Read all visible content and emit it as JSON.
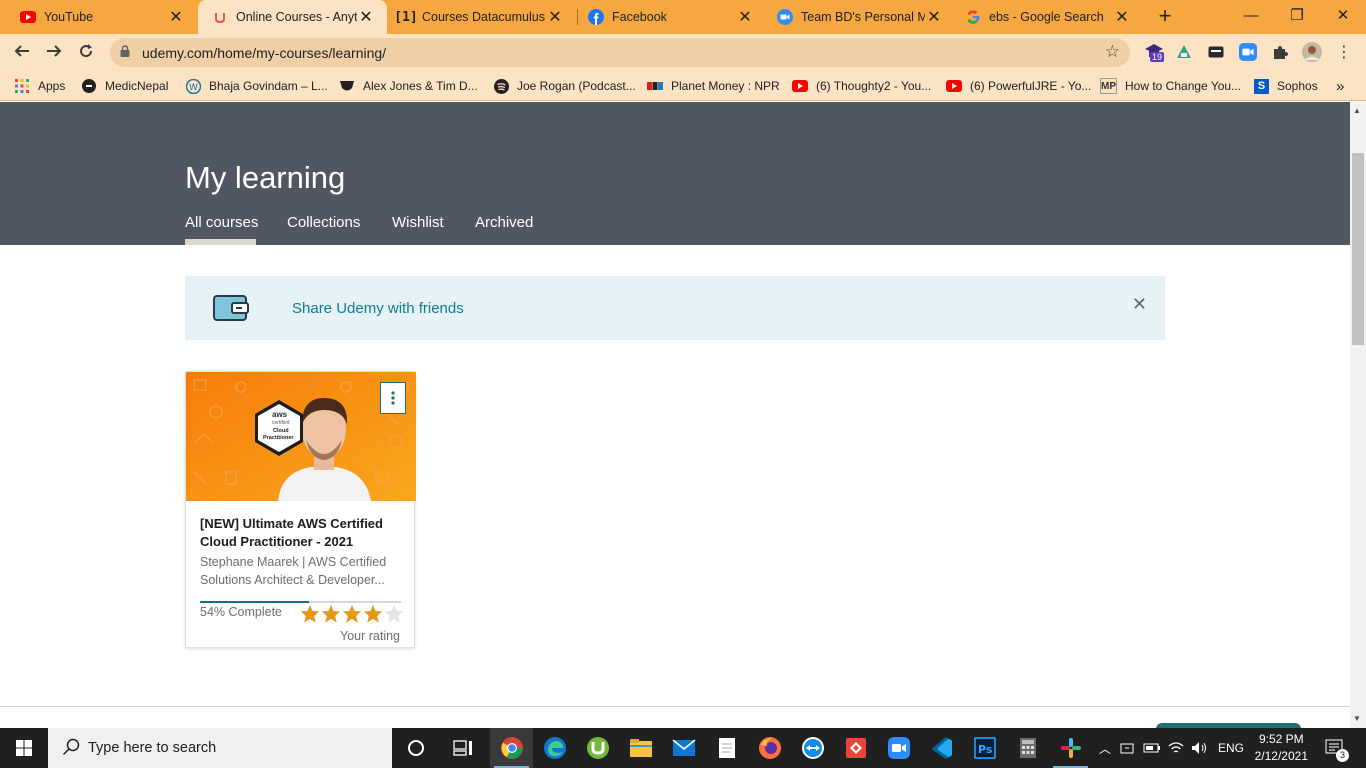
{
  "browser": {
    "tabs": [
      {
        "title": "YouTube",
        "icon": "youtube-icon"
      },
      {
        "title": "Online Courses - Anytin",
        "icon": "udemy-icon",
        "active": true
      },
      {
        "title": "Courses Datacumulus",
        "icon": "datacumulus-icon"
      },
      {
        "title": "Facebook",
        "icon": "facebook-icon"
      },
      {
        "title": "Team BD's Personal Me",
        "icon": "zoom-icon"
      },
      {
        "title": "ebs - Google Search",
        "icon": "google-icon"
      }
    ],
    "new_tab": "+",
    "window_controls": {
      "minimize": "—",
      "restore": "❐",
      "close": "✕"
    },
    "url": "udemy.com/home/my-courses/learning/",
    "extension_badge": "19",
    "bookmarks": [
      {
        "label": "Apps",
        "icon": "apps-grid-icon"
      },
      {
        "label": "MedicNepal",
        "icon": "medicnepal-icon"
      },
      {
        "label": "Bhaja Govindam – L...",
        "icon": "wordpress-icon"
      },
      {
        "label": "Alex Jones & Tim D...",
        "icon": "mask-icon"
      },
      {
        "label": "Joe Rogan (Podcast...",
        "icon": "spotify-icon"
      },
      {
        "label": "Planet Money : NPR",
        "icon": "npr-icon"
      },
      {
        "label": "(6) Thoughty2 - You...",
        "icon": "youtube-icon"
      },
      {
        "label": "(6) PowerfulJRE - Yo...",
        "icon": "youtube-icon"
      },
      {
        "label": "How to Change You...",
        "icon": "mp-icon"
      },
      {
        "label": "Sophos",
        "icon": "sophos-icon"
      }
    ],
    "bookmarks_overflow": "»"
  },
  "page": {
    "heading": "My learning",
    "tabs": [
      "All courses",
      "Collections",
      "Wishlist",
      "Archived"
    ],
    "share_banner": {
      "text": "Share Udemy with friends",
      "close": "✕"
    },
    "course": {
      "badge_brand": "aws",
      "badge_line1": "certified",
      "badge_line2": "Cloud",
      "badge_line3": "Practitioner",
      "title": "[NEW] Ultimate AWS Certified Cloud Practitioner - 2021",
      "author": "Stephane Maarek | AWS Certified Solutions Architect & Developer...",
      "progress_percent": 54,
      "progress_text": "54% Complete",
      "rating_stars": 4,
      "rating_max": 5,
      "rating_label": "Your rating"
    }
  },
  "taskbar": {
    "search_placeholder": "Type here to search",
    "language": "ENG",
    "time": "9:52 PM",
    "date": "2/12/2021",
    "notification_count": "3"
  },
  "colors": {
    "tabstrip": "#f6a740",
    "toolbar": "#fce3c4",
    "hero": "#505763",
    "accent_teal": "#1c6f72",
    "share_bg": "#e6f2f5",
    "star": "#e59819"
  }
}
